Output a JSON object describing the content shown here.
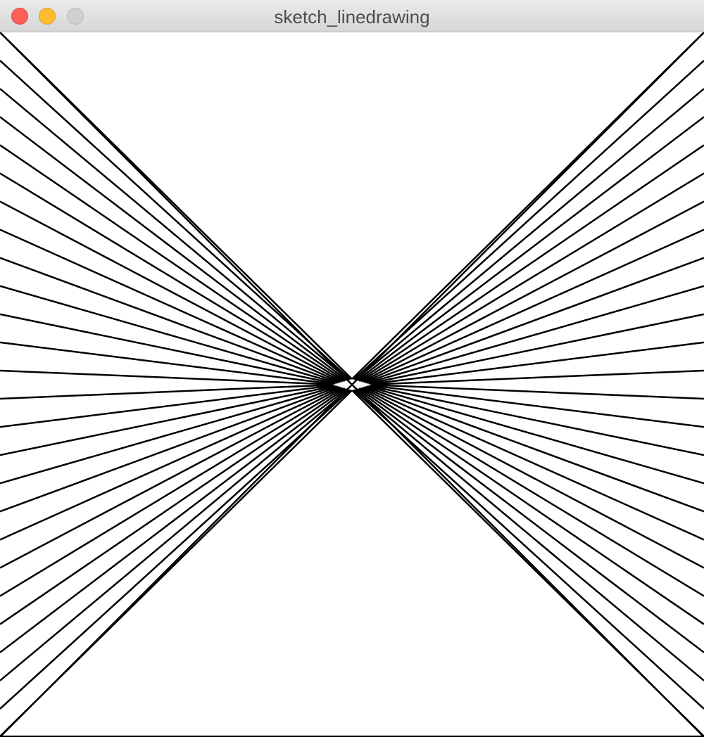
{
  "window": {
    "title": "sketch_linedrawing",
    "buttons": {
      "close_color": "#fc5f57",
      "minimize_color": "#fdbc2e",
      "zoom_color": "#d0d0d0"
    }
  },
  "canvas": {
    "background": "#ffffff",
    "stroke": "#000000",
    "lines_per_side": 26
  }
}
